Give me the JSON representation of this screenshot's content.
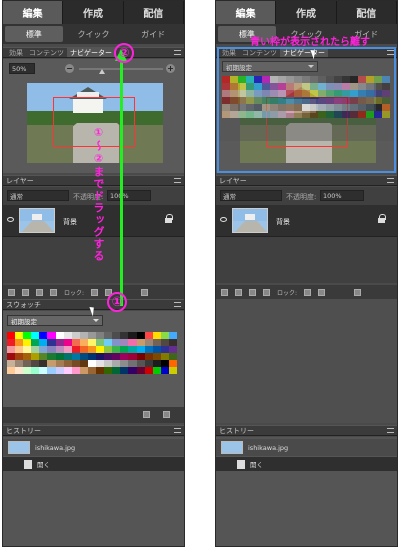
{
  "tabs": [
    "編集",
    "作成",
    "配信"
  ],
  "mode_tabs": [
    "標準",
    "クイック",
    "ガイド"
  ],
  "left": {
    "panel_tabs": [
      "効果",
      "コンテンツ",
      "ナビゲーター"
    ],
    "zoom_value": "50%",
    "zoom_minus": "−",
    "zoom_plus": "+",
    "layers": {
      "title": "レイヤー",
      "blend_mode": "通常",
      "opacity_label": "不透明度:",
      "opacity_value": "100%",
      "layer_name": "背景",
      "lock_label": "ロック:"
    },
    "swatches": {
      "title": "スウォッチ",
      "set_name": "初期設定"
    },
    "history": {
      "title": "ヒストリー",
      "file_name": "ishikawa.jpg",
      "action": "開く"
    },
    "annotations": {
      "start_marker": "①",
      "end_marker": "②",
      "label_num1": "①",
      "label_tilde": "〜",
      "label_num2": "②",
      "instruction_text": "までドラッグする",
      "bottom_marker": "①"
    }
  },
  "right": {
    "panel_tabs": [
      "効果",
      "コンテンツ",
      "ナビゲーター"
    ],
    "set_name": "初期設定",
    "layers": {
      "title": "レイヤー",
      "blend_mode": "通常",
      "opacity_label": "不透明度:",
      "opacity_value": "100%",
      "layer_name": "背景",
      "lock_label": "ロック:"
    },
    "history": {
      "title": "ヒストリー",
      "file_name": "ishikawa.jpg",
      "action": "開く"
    },
    "annotation": "青い枠が表示されたら離す"
  },
  "colors": {
    "annotation_pink": "#ff22dd",
    "arrow_green": "#22ee22",
    "drop_highlight_blue": "#4a90e2",
    "nav_frame_red": "#ff3333"
  }
}
